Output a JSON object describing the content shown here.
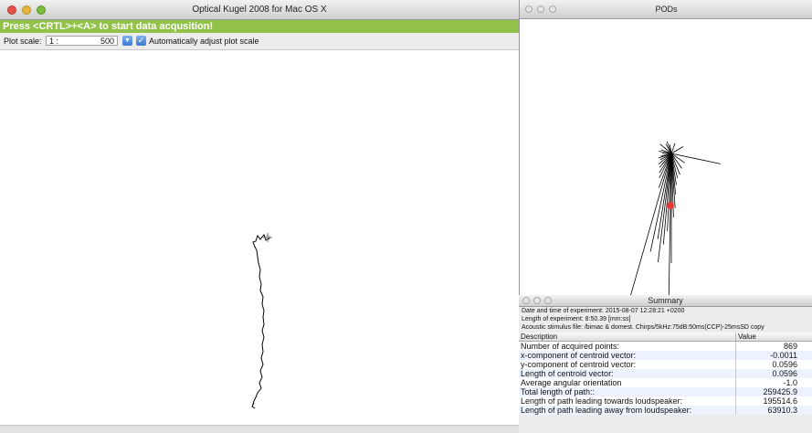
{
  "main_window": {
    "title": "Optical Kugel 2008 for Mac OS X",
    "banner": "Press <CRTL>+<A> to start data acqusition!",
    "plot_scale_label": "Plot scale:",
    "scale_prefix": "1 :",
    "scale_value": "500",
    "auto_adjust_label": "Automatically adjust plot scale",
    "auto_adjust_checked": true
  },
  "pods_window": {
    "title": "PODs"
  },
  "summary_window": {
    "title": "Summary",
    "meta": [
      "Date and time of experiment: 2015-08-07 12:28:21 +0200",
      "Length of experiment: 8:50.39 [mm:ss]",
      "Acoustic stimulus file: /bimac & domest. Chirps/5kHz:75dB:50ms(CCP)-25msSD copy"
    ],
    "columns": [
      "Description",
      "Value"
    ],
    "rows": [
      {
        "desc": "Number of acquired points:",
        "value": "869"
      },
      {
        "desc": "x-component of centroid vector:",
        "value": "-0.0011"
      },
      {
        "desc": "y-component of centroid vector:",
        "value": "0.0596"
      },
      {
        "desc": "Length of centroid vector:",
        "value": "0.0596"
      },
      {
        "desc": "Average angular orientation",
        "value": "-1.0"
      },
      {
        "desc": "Total length of path::",
        "value": "259425.9"
      },
      {
        "desc": "Length of path leading towards loudspeaker:",
        "value": "195514.6"
      },
      {
        "desc": "Length of path leading away from loudspeaker:",
        "value": "63910.3"
      }
    ]
  },
  "colors": {
    "banner": "#93c24b",
    "pod_marker": "#e53935",
    "zebra_row": "#edf3fe"
  }
}
